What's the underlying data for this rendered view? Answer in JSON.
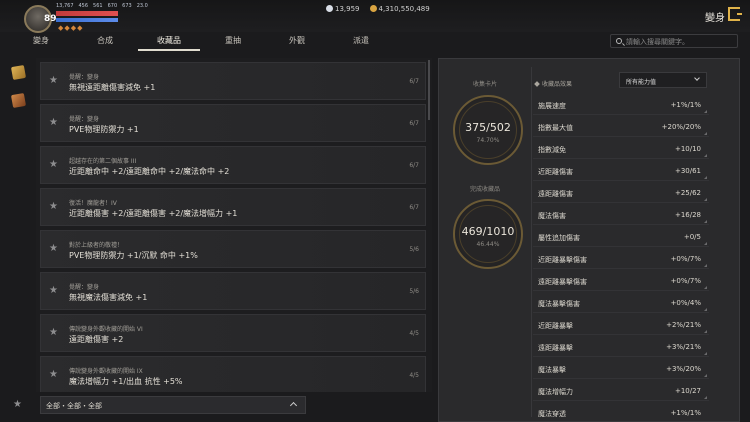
{
  "player": {
    "level": "89",
    "stats": [
      "13,767",
      "456",
      "561",
      "670",
      "673",
      "23.0"
    ]
  },
  "currency": {
    "diamonds": "13,959",
    "gold": "4,310,550,489",
    "diamond_color": "#d8dde6",
    "gold_color": "#d9a441"
  },
  "header": {
    "title": "變身"
  },
  "tabs": [
    {
      "label": "變身",
      "active": false
    },
    {
      "label": "合成",
      "active": false
    },
    {
      "label": "收藏品",
      "active": true
    },
    {
      "label": "重抽",
      "active": false
    },
    {
      "label": "外觀",
      "active": false
    },
    {
      "label": "派遣",
      "active": false
    }
  ],
  "search": {
    "placeholder": "請輸入搜尋關鍵字。"
  },
  "cards": [
    {
      "category": "覺醒：變身",
      "effect": "無視遠距離傷害減免 +1",
      "count": "6/7"
    },
    {
      "category": "覺醒：變身",
      "effect": "PVE物理防禦力 +1",
      "count": "6/7"
    },
    {
      "category": "超越存在的第二個故事 III",
      "effect": "近距離命中 +2/遠距離命中 +2/魔法命中 +2",
      "count": "6/7"
    },
    {
      "category": "復活！魔龍者！IV",
      "effect": "近距離傷害 +2/遠距離傷害 +2/魔法增幅力 +1",
      "count": "6/7"
    },
    {
      "category": "對於上級者的敬禮！",
      "effect": "PVE物理防禦力 +1/沉默 命中 +1%",
      "count": "5/6"
    },
    {
      "category": "覺醒：變身",
      "effect": "無視魔法傷害減免 +1",
      "count": "5/6"
    },
    {
      "category": "傳說變身外觀收藏的開始 VI",
      "effect": "遠距離傷害 +2",
      "count": "4/5"
    },
    {
      "category": "傳說變身外觀收藏的開始 IX",
      "effect": "魔法增幅力 +1/出血 抗性 +5%",
      "count": "4/5"
    }
  ],
  "filter": {
    "label": "全部・全部・全部"
  },
  "collection_cards": {
    "label": "收集卡片",
    "value": "375/502",
    "percent": "74.70%"
  },
  "completed_collections": {
    "label": "完成收藏品",
    "value": "469/1010",
    "percent": "46.44%"
  },
  "effects_panel": {
    "label": "收藏品效果",
    "dropdown": "所有能力值",
    "stats": [
      {
        "name": "施展速度",
        "value": "+1%/1%"
      },
      {
        "name": "指數最大值",
        "value": "+20%/20%"
      },
      {
        "name": "指數減免",
        "value": "+10/10"
      },
      {
        "name": "近距離傷害",
        "value": "+30/61"
      },
      {
        "name": "遠距離傷害",
        "value": "+25/62"
      },
      {
        "name": "魔法傷害",
        "value": "+16/28"
      },
      {
        "name": "屬性追加傷害",
        "value": "+0/5"
      },
      {
        "name": "近距離暴擊傷害",
        "value": "+0%/7%"
      },
      {
        "name": "遠距離暴擊傷害",
        "value": "+0%/7%"
      },
      {
        "name": "魔法暴擊傷害",
        "value": "+0%/4%"
      },
      {
        "name": "近距離暴擊",
        "value": "+2%/21%"
      },
      {
        "name": "遠距離暴擊",
        "value": "+3%/21%"
      },
      {
        "name": "魔法暴擊",
        "value": "+3%/20%"
      },
      {
        "name": "魔法增幅力",
        "value": "+10/27"
      },
      {
        "name": "魔法穿透",
        "value": "+1%/1%"
      }
    ]
  }
}
